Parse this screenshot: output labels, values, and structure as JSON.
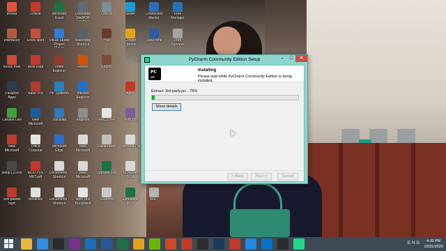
{
  "desktop": {
    "icons": [
      {
        "label": "picasa",
        "color": "#e0533b",
        "col": 0,
        "row": 0
      },
      {
        "label": "Oracle",
        "color": "#c0392b",
        "col": 1,
        "row": 0
      },
      {
        "label": "Microsoft Excel",
        "color": "#1e7145",
        "col": 2,
        "row": 0
      },
      {
        "label": "Download Jitsi/PDF Cmdtool",
        "color": "#5a6b7a",
        "col": 3,
        "row": 0
      },
      {
        "label": "Orbcus",
        "color": "#7e8c99",
        "col": 4,
        "row": 0
      },
      {
        "label": "Skype",
        "color": "#1d9bd7",
        "col": 5,
        "row": 0
      },
      {
        "label": "Connection Master",
        "color": "#2c6fb4",
        "col": 6,
        "row": 0
      },
      {
        "label": "Free Manager",
        "color": "#2474b8",
        "col": 7,
        "row": 0
      },
      {
        "label": "Interfaced",
        "color": "#b45a3c",
        "col": 0,
        "row": 1
      },
      {
        "label": "Excel spirit",
        "color": "#c94f3d",
        "col": 1,
        "row": 1
      },
      {
        "label": "Visual Studio Project Player",
        "color": "#2a7ed3",
        "col": 2,
        "row": 1
      },
      {
        "label": "Watchdog Shortcut",
        "color": "#55626e",
        "col": 3,
        "row": 1
      },
      {
        "label": "HM",
        "color": "#6b3b2a",
        "col": 4,
        "row": 1
      },
      {
        "label": "Google Chrome",
        "color": "#e3a21a",
        "col": 5,
        "row": 1
      },
      {
        "label": "TallyPrime",
        "color": "#2a5ba8",
        "col": 6,
        "row": 1
      },
      {
        "label": "Print Services",
        "color": "#a3a3a3",
        "col": 7,
        "row": 1
      },
      {
        "label": "65995 Intel",
        "color": "#d44a3a",
        "col": 0,
        "row": 2
      },
      {
        "label": "Bliss Data",
        "color": "#c0392b",
        "col": 1,
        "row": 2
      },
      {
        "label": "Video Explorer",
        "color": "#8f3a2a",
        "col": 2,
        "row": 2
      },
      {
        "label": "Firefox",
        "color": "#d35400",
        "col": 3,
        "row": 2
      },
      {
        "label": "Khushi",
        "color": "#7a4b3a",
        "col": 4,
        "row": 2
      },
      {
        "label": "Passport Apps",
        "color": "#2c3e50",
        "col": 0,
        "row": 3
      },
      {
        "label": "Basic Pro",
        "color": "#b03a2e",
        "col": 1,
        "row": 3
      },
      {
        "label": "HP Systems",
        "color": "#2980b9",
        "col": 2,
        "row": 3
      },
      {
        "label": "Internet Explorer",
        "color": "#1f73c6",
        "col": 3,
        "row": 3
      },
      {
        "label": "Apps",
        "color": "#c0392b",
        "col": 5,
        "row": 3
      },
      {
        "label": "Chrome Dev",
        "color": "#3f9f3f",
        "col": 0,
        "row": 4
      },
      {
        "label": "New Microsoft",
        "color": "#1b5e9e",
        "col": 1,
        "row": 4
      },
      {
        "label": "Translate",
        "color": "#2e7bbf",
        "col": 2,
        "row": 4
      },
      {
        "label": "englishs",
        "color": "#8d8d8d",
        "col": 3,
        "row": 4
      },
      {
        "label": "AMCS x64",
        "color": "#e7e7e7",
        "col": 4,
        "row": 4
      },
      {
        "label": "Vivid Typ",
        "color": "#7b5e9a",
        "col": 5,
        "row": 4
      },
      {
        "label": "New Microsoft",
        "color": "#c0392b",
        "col": 0,
        "row": 5
      },
      {
        "label": "Office Corporat",
        "color": "#e4e4e4",
        "col": 1,
        "row": 5
      },
      {
        "label": "Microsoft Edge",
        "color": "#2a6fcf",
        "col": 2,
        "row": 5
      },
      {
        "label": "New Microsoft",
        "color": "#d9d9d9",
        "col": 3,
        "row": 5
      },
      {
        "label": "PassportAp",
        "color": "#bfbfbf",
        "col": 4,
        "row": 5
      },
      {
        "label": "Personal File",
        "color": "#d9d9d9",
        "col": 5,
        "row": 5
      },
      {
        "label": "setup (1) exe",
        "color": "#4a4a4a",
        "col": 0,
        "row": 6
      },
      {
        "label": "MOU PDF MKT.pdf",
        "color": "#c0392b",
        "col": 1,
        "row": 6
      },
      {
        "label": "Documents - Shortcut",
        "color": "#d8d8d8",
        "col": 2,
        "row": 6
      },
      {
        "label": "New Microsoft",
        "color": "#d9d9d9",
        "col": 3,
        "row": 6
      },
      {
        "label": "Upgrade.xlsx",
        "color": "#1e7145",
        "col": 4,
        "row": 6
      },
      {
        "label": "PLASMA 2018",
        "color": "#d9d9d9",
        "col": 5,
        "row": 6
      },
      {
        "label": "Shri pawan Isgrt",
        "color": "#c0392b",
        "col": 0,
        "row": 7
      },
      {
        "label": "Bookfolio",
        "color": "#e0e0e0",
        "col": 1,
        "row": 7
      },
      {
        "label": "Documents - Shortcut",
        "color": "#d8d8d8",
        "col": 2,
        "row": 7
      },
      {
        "label": "New Text Document",
        "color": "#e6e6e6",
        "col": 3,
        "row": 7
      },
      {
        "label": "Scanned",
        "color": "#c9c9c9",
        "col": 4,
        "row": 7
      },
      {
        "label": "Excelbible 2016",
        "color": "#1e7145",
        "col": 5,
        "row": 7
      },
      {
        "label": "Wal...",
        "color": "#b5b5b5",
        "col": 6,
        "row": 7
      }
    ]
  },
  "window": {
    "title": "PyCharm Community Edition Setup",
    "min": "–",
    "max": "□",
    "close": "✕",
    "logo_text": "PC",
    "header_title": "Installing",
    "header_subtitle": "Please wait while PyCharm Community Edition is being installed.",
    "status": "Extract: 3rd-party.jar... 75%",
    "progress": 0.02,
    "show_details": "Show details",
    "back": "< Back",
    "next": "Next >",
    "cancel": "Cancel"
  },
  "taskbar": {
    "apps": [
      {
        "name": "file-explorer-icon",
        "color": "#e8b73c"
      },
      {
        "name": "internet-explorer-icon",
        "color": "#2f8fe0"
      },
      {
        "name": "media-icon",
        "color": "#2a2a2a"
      },
      {
        "name": "onenote-icon",
        "color": "#7b2f8f"
      },
      {
        "name": "hp-icon",
        "color": "#1a6fb8"
      },
      {
        "name": "word-icon",
        "color": "#2b579a"
      },
      {
        "name": "excel-icon",
        "color": "#1e7145"
      },
      {
        "name": "chrome-icon",
        "color": "#e3a21a"
      },
      {
        "name": "store-icon",
        "color": "#6bb700"
      },
      {
        "name": "powerpoint-icon",
        "color": "#d24726"
      },
      {
        "name": "typing-icon",
        "color": "#c0392b"
      },
      {
        "name": "pdf-icon",
        "color": "#2c2c2c"
      },
      {
        "name": "steam-icon",
        "color": "#1b3a57"
      },
      {
        "name": "dot-icon",
        "color": "#c0392b"
      },
      {
        "name": "update-icon",
        "color": "#1e88e5"
      },
      {
        "name": "outlook-icon",
        "color": "#0072c6"
      },
      {
        "name": "obs-icon",
        "color": "#2b2b2b"
      },
      {
        "name": "pycharm-icon",
        "color": "#21d789"
      },
      {
        "name": "hidden-icon",
        "color": "#3d4a54"
      }
    ],
    "lang": "ENG",
    "time": "4:30 PM",
    "date": "10/31/2020"
  }
}
